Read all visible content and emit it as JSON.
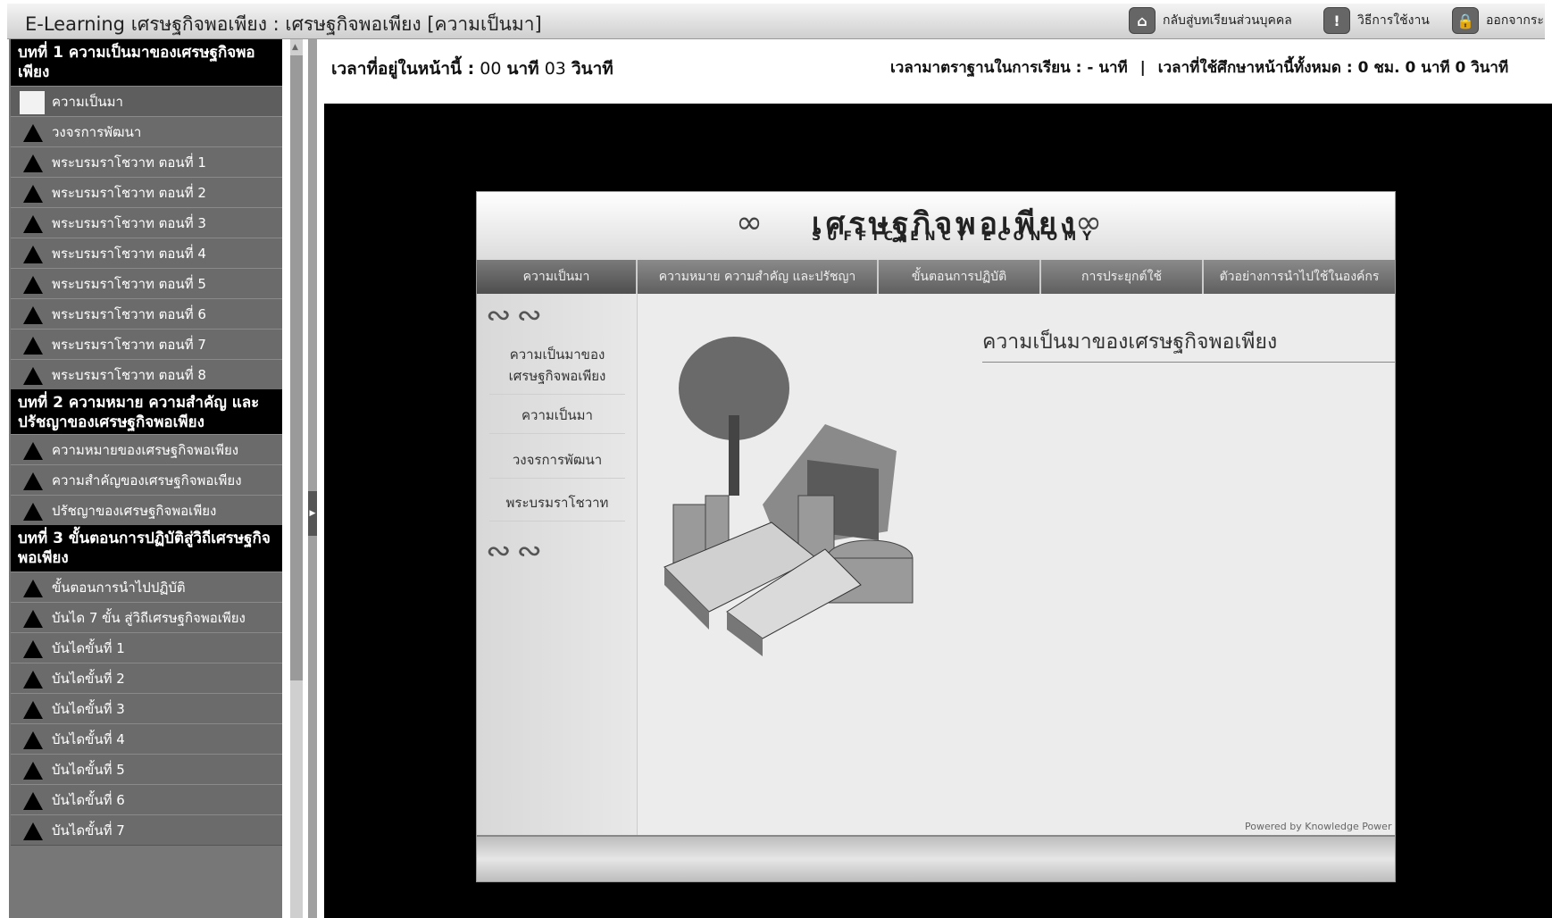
{
  "window": {
    "title": "E-Learning เศรษฐกิจพอเพียง : เศรษฐกิจพอเพียง [ความเป็นมา]"
  },
  "top_links": {
    "home": "กลับสู่บทเรียนส่วนบุคคล",
    "help": "วิธีการใช้งาน",
    "exit": "ออกจากระ"
  },
  "sidebar": {
    "chapters": [
      {
        "title": "บทที่ 1 ความเป็นมาของเศรษฐกิจพอเพียง",
        "items": [
          "ความเป็นมา",
          "วงจรการพัฒนา",
          "พระบรมราโชวาท ตอนที่ 1",
          "พระบรมราโชวาท ตอนที่ 2",
          "พระบรมราโชวาท ตอนที่ 3",
          "พระบรมราโชวาท ตอนที่ 4",
          "พระบรมราโชวาท ตอนที่ 5",
          "พระบรมราโชวาท ตอนที่ 6",
          "พระบรมราโชวาท ตอนที่ 7",
          "พระบรมราโชวาท ตอนที่ 8"
        ]
      },
      {
        "title": "บทที่ 2 ความหมาย ความสำคัญ และปรัชญาของเศรษฐกิจพอเพียง",
        "items": [
          "ความหมายของเศรษฐกิจพอเพียง",
          "ความสำคัญของเศรษฐกิจพอเพียง",
          "ปรัชญาของเศรษฐกิจพอเพียง"
        ]
      },
      {
        "title": "บทที่ 3 ขั้นตอนการปฏิบัติสู่วิถีเศรษฐกิจพอเพียง",
        "items": [
          "ขั้นตอนการนำไปปฏิบัติ",
          "บันได 7 ขั้น สู่วิถีเศรษฐกิจพอเพียง",
          "บันไดขั้นที่ 1",
          "บันไดขั้นที่ 2",
          "บันไดขั้นที่ 3",
          "บันไดขั้นที่ 4",
          "บันไดขั้นที่ 5",
          "บันไดขั้นที่ 6",
          "บันไดขั้นที่ 7"
        ]
      }
    ]
  },
  "timer": {
    "label": "เวลาที่อยู่ในหน้านี้ :",
    "minutes": "00",
    "minutes_unit": "นาที",
    "seconds": "03",
    "seconds_unit": "วินาที",
    "standard_label": "เวลามาตราฐานในการเรียน : - นาที",
    "separator": "|",
    "total_label": "เวลาที่ใช้ศึกษาหน้านี้ทั้งหมด : 0 ชม. 0 นาที 0 วินาที"
  },
  "course": {
    "logo_th": "เศรษฐกิจพอเพียง",
    "logo_en": "SUFFICIENCY ECONOMY",
    "nav": [
      "ความเป็นมา",
      "ความหมาย ความสำคัญ และปรัชญา",
      "ขั้นตอนการปฏิบัติ",
      "การประยุกต์ใช้",
      "ตัวอย่างการนำไปใช้ในองค์กร"
    ],
    "side_links": [
      "ความเป็นมาของเศรษฐกิจพอเพียง",
      "ความเป็นมา",
      "วงจรการพัฒนา",
      "พระบรมราโชวาท"
    ],
    "content_title": "ความเป็นมาของเศรษฐกิจพอเพียง",
    "powered": "Powered by Knowledge Power"
  }
}
